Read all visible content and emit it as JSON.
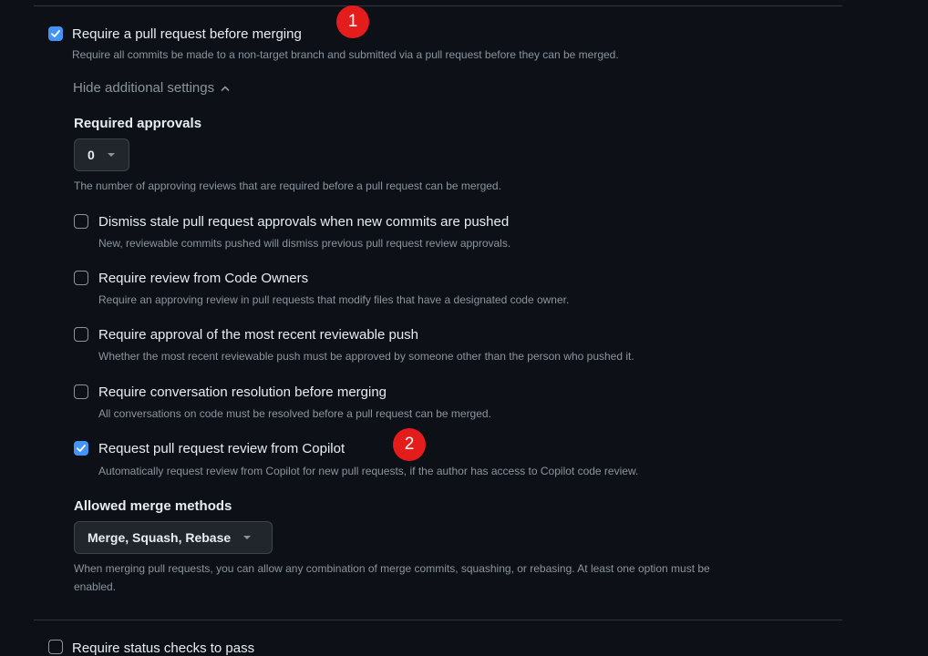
{
  "pr_rule": {
    "label": "Require a pull request before merging",
    "description": "Require all commits be made to a non-target branch and submitted via a pull request before they can be merged.",
    "checked": true
  },
  "settings_toggle": {
    "label": "Hide additional settings"
  },
  "required_approvals": {
    "heading": "Required approvals",
    "value": "0",
    "description": "The number of approving reviews that are required before a pull request can be merged."
  },
  "options": [
    {
      "label": "Dismiss stale pull request approvals when new commits are pushed",
      "description": "New, reviewable commits pushed will dismiss previous pull request review approvals.",
      "checked": false
    },
    {
      "label": "Require review from Code Owners",
      "description": "Require an approving review in pull requests that modify files that have a designated code owner.",
      "checked": false
    },
    {
      "label": "Require approval of the most recent reviewable push",
      "description": "Whether the most recent reviewable push must be approved by someone other than the person who pushed it.",
      "checked": false
    },
    {
      "label": "Require conversation resolution before merging",
      "description": "All conversations on code must be resolved before a pull request can be merged.",
      "checked": false
    },
    {
      "label": "Request pull request review from Copilot",
      "description": "Automatically request review from Copilot for new pull requests, if the author has access to Copilot code review.",
      "checked": true
    }
  ],
  "merge_methods": {
    "heading": "Allowed merge methods",
    "value": "Merge, Squash, Rebase",
    "description_line1": "When merging pull requests, you can allow any combination of merge commits, squashing, or rebasing. At least one option must be",
    "description_line2": "enabled."
  },
  "status_checks": {
    "label": "Require status checks to pass",
    "checked": false
  },
  "annotations": {
    "marker1": "1",
    "marker2": "2",
    "color": "#e51c1c"
  },
  "colors": {
    "background": "#0d1117",
    "accent": "#4493f8",
    "muted_text": "#8b949e"
  }
}
